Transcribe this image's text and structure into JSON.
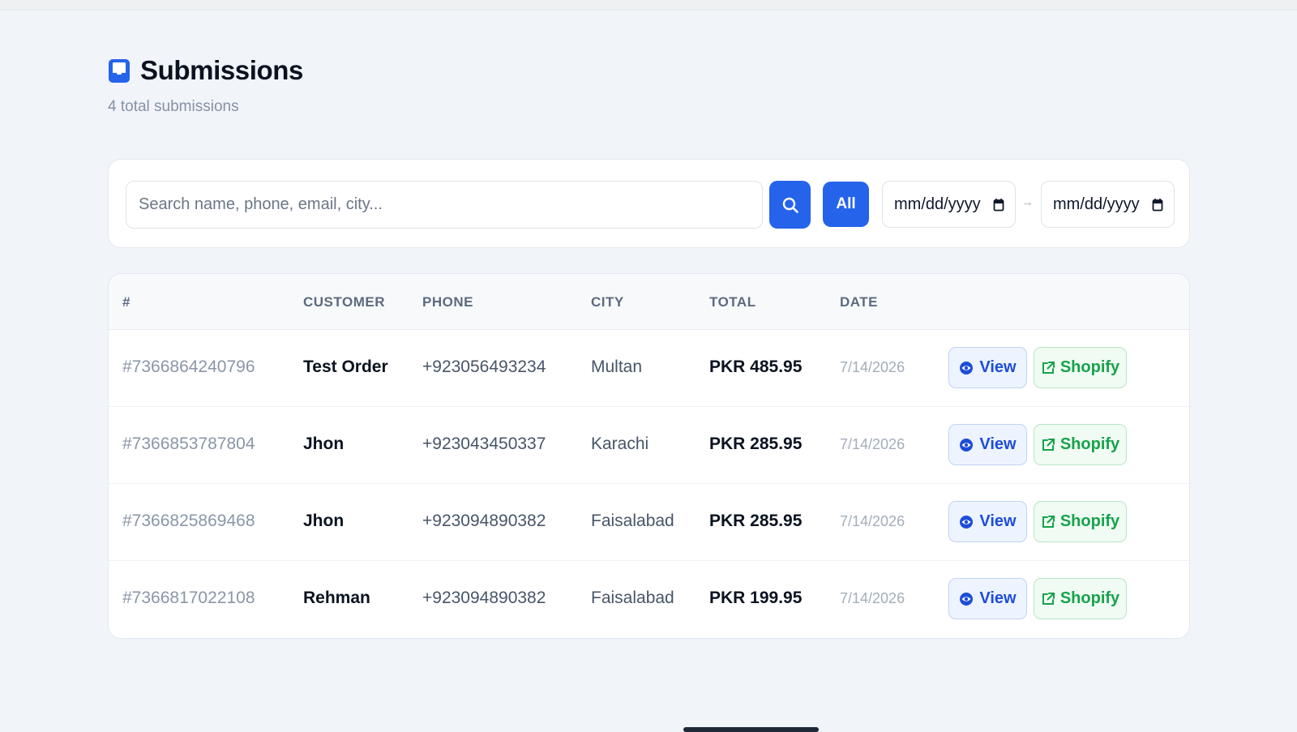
{
  "header": {
    "title": "Submissions",
    "icon": "inbox-icon",
    "subtitle": "4 total submissions"
  },
  "filters": {
    "search_placeholder": "Search name, phone, email, city...",
    "search_value": "",
    "search_button_icon": "search-icon",
    "all_label": "All",
    "date_from": "mm/dd/yyyy",
    "date_to": "mm/dd/yyyy",
    "range_separator": "→"
  },
  "table": {
    "columns": [
      "#",
      "CUSTOMER",
      "PHONE",
      "CITY",
      "TOTAL",
      "DATE"
    ],
    "rows": [
      {
        "id": "#7366864240796",
        "customer": "Test Order",
        "phone": "+923056493234",
        "city": "Multan",
        "total": "PKR 485.95",
        "date": "7/14/2026"
      },
      {
        "id": "#7366853787804",
        "customer": "Jhon",
        "phone": "+923043450337",
        "city": "Karachi",
        "total": "PKR 285.95",
        "date": "7/14/2026"
      },
      {
        "id": "#7366825869468",
        "customer": "Jhon",
        "phone": "+923094890382",
        "city": "Faisalabad",
        "total": "PKR 285.95",
        "date": "7/14/2026"
      },
      {
        "id": "#7366817022108",
        "customer": "Rehman",
        "phone": "+923094890382",
        "city": "Faisalabad",
        "total": "PKR 199.95",
        "date": "7/14/2026"
      }
    ],
    "view_label": "View",
    "shopify_label": "Shopify"
  },
  "colors": {
    "accent": "#2563eb",
    "success": "#16a34a",
    "background": "#f1f4f8"
  }
}
